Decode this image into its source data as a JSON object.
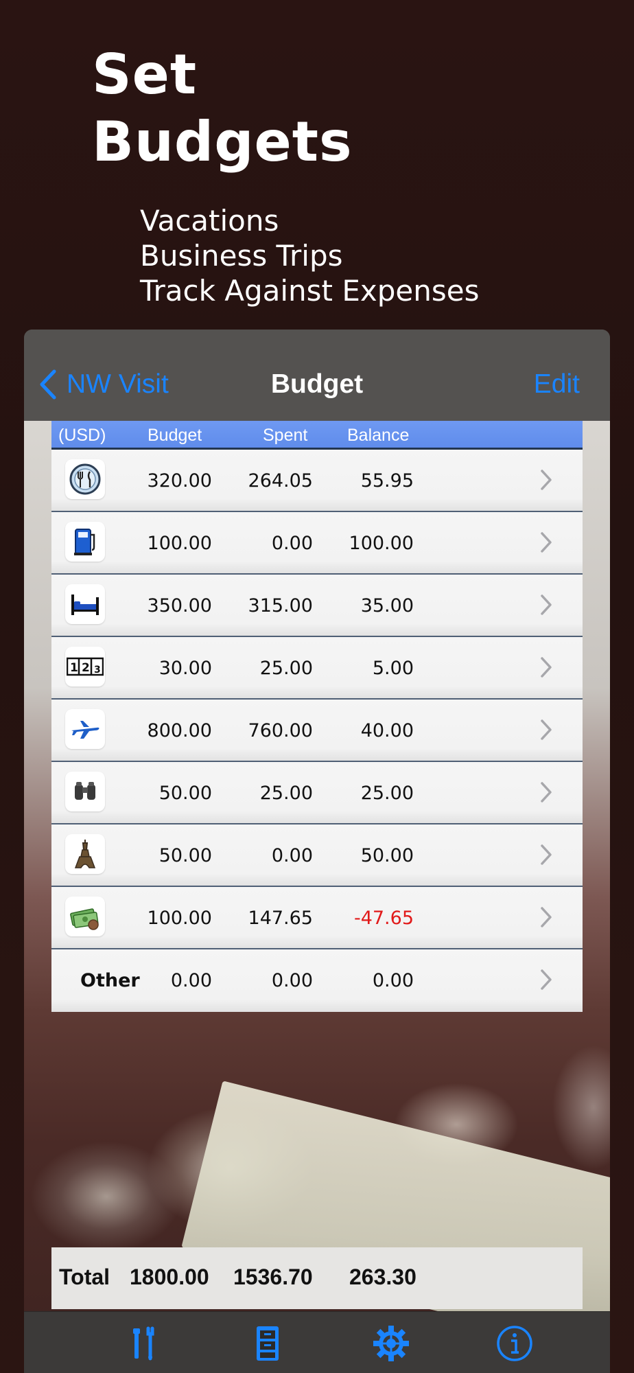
{
  "promo": {
    "title_line1": "Set",
    "title_line2": "Budgets",
    "bullets": [
      "Vacations",
      "Business Trips",
      "Track Against Expenses"
    ]
  },
  "nav": {
    "back_label": "NW Visit",
    "title": "Budget",
    "edit_label": "Edit"
  },
  "table": {
    "headers": {
      "currency": "(USD)",
      "budget": "Budget",
      "spent": "Spent",
      "balance": "Balance"
    },
    "rows": [
      {
        "icon": "dining-icon",
        "budget": "320.00",
        "spent": "264.05",
        "balance": "55.95"
      },
      {
        "icon": "fuel-pump-icon",
        "budget": "100.00",
        "spent": "0.00",
        "balance": "100.00"
      },
      {
        "icon": "bed-icon",
        "budget": "350.00",
        "spent": "315.00",
        "balance": "35.00"
      },
      {
        "icon": "numbers-icon",
        "budget": "30.00",
        "spent": "25.00",
        "balance": "5.00"
      },
      {
        "icon": "airplane-icon",
        "budget": "800.00",
        "spent": "760.00",
        "balance": "40.00"
      },
      {
        "icon": "binoculars-icon",
        "budget": "50.00",
        "spent": "25.00",
        "balance": "25.00"
      },
      {
        "icon": "eiffel-tower-icon",
        "budget": "50.00",
        "spent": "0.00",
        "balance": "50.00"
      },
      {
        "icon": "money-icon",
        "budget": "100.00",
        "spent": "147.65",
        "balance": "-47.65"
      },
      {
        "label": "Other",
        "budget": "0.00",
        "spent": "0.00",
        "balance": "0.00"
      }
    ]
  },
  "totals": {
    "label": "Total",
    "budget": "1800.00",
    "spent": "1536.70",
    "balance": "263.30"
  },
  "tabbar": {
    "icons": [
      "tools-icon",
      "file-cabinet-icon",
      "gear-icon",
      "info-icon"
    ]
  },
  "colors": {
    "accent": "#1a84ff",
    "header_blue": "#6f99f2",
    "negative": "#e11a1a",
    "background": "#2a1412"
  }
}
